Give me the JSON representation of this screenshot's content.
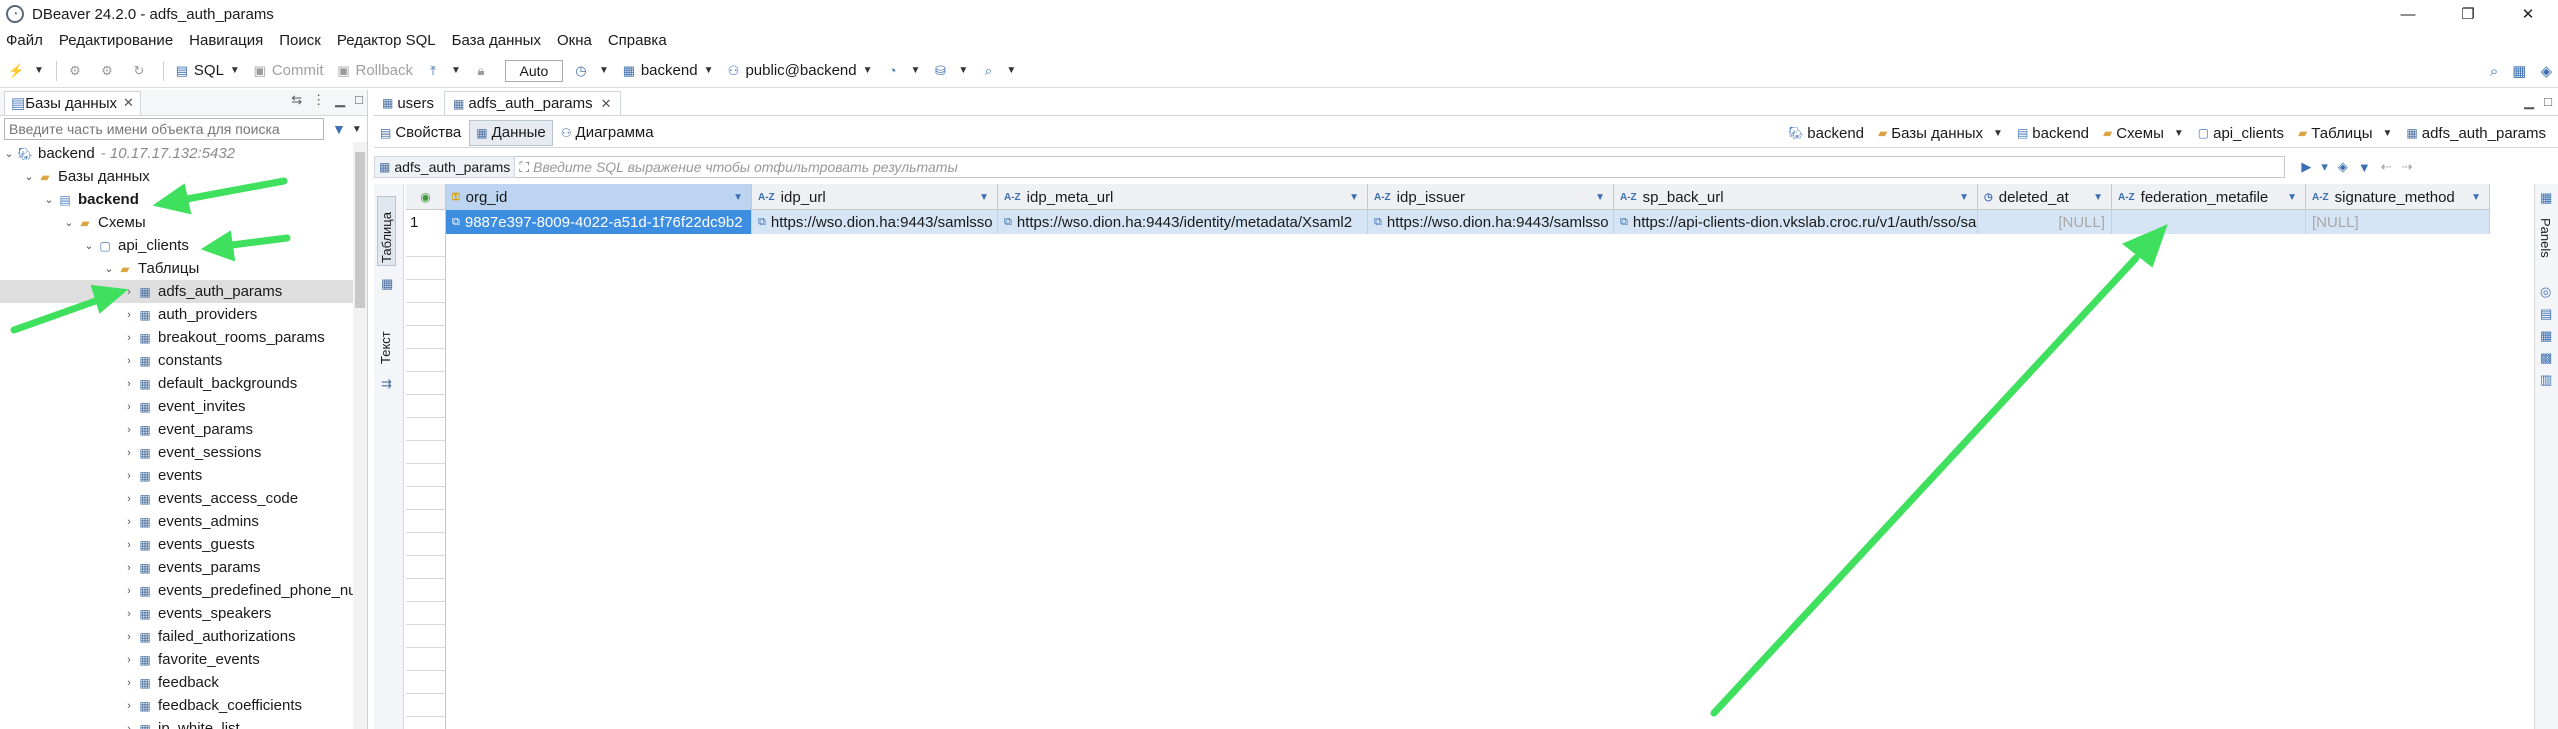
{
  "window": {
    "title": "DBeaver 24.2.0 - adfs_auth_params",
    "controls": [
      "—",
      "❐",
      "✕"
    ]
  },
  "menu": [
    "Файл",
    "Редактирование",
    "Навигация",
    "Поиск",
    "Редактор SQL",
    "База данных",
    "Окна",
    "Справка"
  ],
  "toolbar": {
    "sql": "SQL",
    "commit": "Commit",
    "rollback": "Rollback",
    "mode": "Auto",
    "datasource": "backend",
    "schema": "public@backend"
  },
  "navigator": {
    "tab_label": "Базы данных",
    "filter_placeholder": "Введите часть имени объекта для поиска",
    "tree": [
      {
        "label": "backend",
        "host": "- 10.17.17.132:5432"
      },
      {
        "label": "Базы данных"
      },
      {
        "label": "backend"
      },
      {
        "label": "Схемы"
      },
      {
        "label": "api_clients"
      },
      {
        "label": "Таблицы"
      },
      {
        "label": "adfs_auth_params"
      },
      {
        "label": "auth_providers"
      },
      {
        "label": "breakout_rooms_params"
      },
      {
        "label": "constants"
      },
      {
        "label": "default_backgrounds"
      },
      {
        "label": "event_invites"
      },
      {
        "label": "event_params"
      },
      {
        "label": "event_sessions"
      },
      {
        "label": "events"
      },
      {
        "label": "events_access_code"
      },
      {
        "label": "events_admins"
      },
      {
        "label": "events_guests"
      },
      {
        "label": "events_params"
      },
      {
        "label": "events_predefined_phone_nu"
      },
      {
        "label": "events_speakers"
      },
      {
        "label": "failed_authorizations"
      },
      {
        "label": "favorite_events"
      },
      {
        "label": "feedback"
      },
      {
        "label": "feedback_coefficients"
      },
      {
        "label": "ip_white_list"
      }
    ]
  },
  "editor": {
    "tabs": [
      {
        "label": "users"
      },
      {
        "label": "adfs_auth_params"
      }
    ],
    "subtabs": [
      "Свойства",
      "Данные",
      "Диаграмма"
    ],
    "breadcrumbs": [
      "backend",
      "Базы данных",
      "backend",
      "Схемы",
      "api_clients",
      "Таблицы",
      "adfs_auth_params"
    ],
    "filter_table": "adfs_auth_params",
    "filter_placeholder": "Введите SQL выражение чтобы отфильтровать результаты",
    "side_left": [
      "Таблица",
      "Текст"
    ],
    "side_right": "Panels"
  },
  "grid": {
    "columns": [
      {
        "name": "org_id",
        "type": "key"
      },
      {
        "name": "idp_url",
        "type": "A-Z"
      },
      {
        "name": "idp_meta_url",
        "type": "A-Z"
      },
      {
        "name": "idp_issuer",
        "type": "A-Z"
      },
      {
        "name": "sp_back_url",
        "type": "A-Z"
      },
      {
        "name": "deleted_at",
        "type": "clock"
      },
      {
        "name": "federation_metafile",
        "type": "A-Z"
      },
      {
        "name": "signature_method",
        "type": "A-Z"
      }
    ],
    "rows": [
      {
        "num": "1",
        "cells": [
          "9887e397-8009-4022-a51d-1f76f22dc9b2",
          "https://wso.dion.ha:9443/samlsso",
          "https://wso.dion.ha:9443/identity/metadata/Xsaml2",
          "https://wso.dion.ha:9443/samlsso",
          "https://api-clients-dion.vkslab.croc.ru/v1/auth/sso/sa",
          "[NULL]",
          "",
          "[NULL]"
        ]
      }
    ]
  },
  "colors": {
    "annotation_arrow": "#3ee05e",
    "selection": "#3d8ee0",
    "row_highlight": "#d6e5f6"
  }
}
